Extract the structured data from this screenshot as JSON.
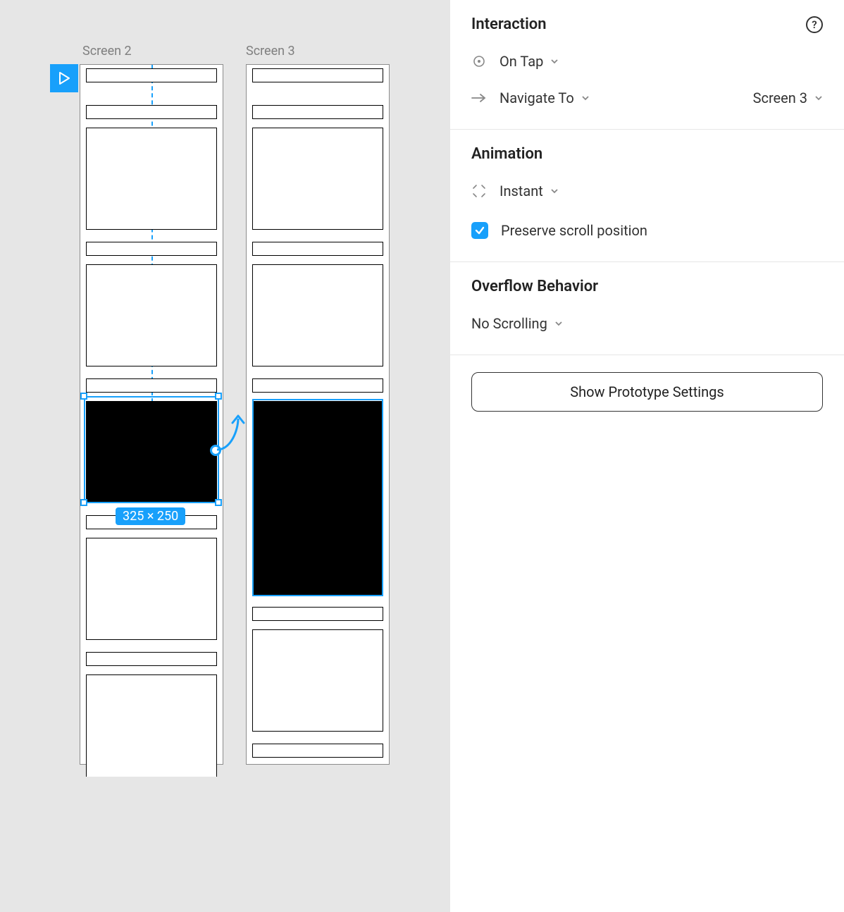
{
  "canvas": {
    "screen2_label": "Screen 2",
    "screen3_label": "Screen 3",
    "selection_size": "325 × 250"
  },
  "panel": {
    "interaction": {
      "title": "Interaction",
      "trigger": "On Tap",
      "action": "Navigate To",
      "destination": "Screen 3"
    },
    "animation": {
      "title": "Animation",
      "type": "Instant",
      "preserve_scroll_label": "Preserve scroll position",
      "preserve_scroll_checked": true
    },
    "overflow": {
      "title": "Overflow Behavior",
      "value": "No Scrolling"
    },
    "settings_button": "Show Prototype Settings",
    "help_glyph": "?"
  }
}
